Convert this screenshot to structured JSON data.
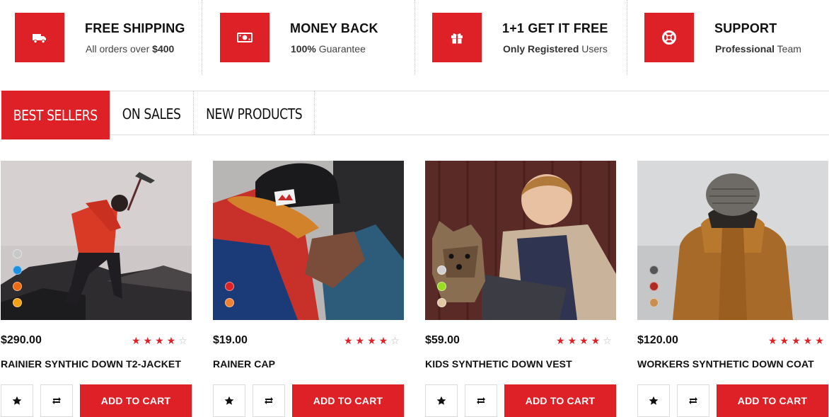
{
  "features": [
    {
      "icon": "truck-icon",
      "title": "FREE SHIPPING",
      "sub_pre": "All orders over ",
      "sub_bold": "$400",
      "sub_post": ""
    },
    {
      "icon": "money-icon",
      "title": "MONEY BACK",
      "sub_pre": "",
      "sub_bold": "100%",
      "sub_post": " Guarantee"
    },
    {
      "icon": "gift-icon",
      "title": "1+1 GET IT FREE",
      "sub_pre": "",
      "sub_bold": "Only Registered",
      "sub_post": " Users"
    },
    {
      "icon": "lifebuoy-icon",
      "title": "SUPPORT",
      "sub_pre": "",
      "sub_bold": "Professional",
      "sub_post": " Team"
    }
  ],
  "tabs": [
    {
      "label": "BEST SELLERS",
      "active": true
    },
    {
      "label": "ON SALES",
      "active": false
    },
    {
      "label": "NEW PRODUCTS",
      "active": false
    }
  ],
  "colors": {
    "accent": "#dd2127"
  },
  "products": [
    {
      "name": "RAINIER SYNTHIC DOWN T2-JACKET",
      "price": "$290.00",
      "rating": 4,
      "max_rating": 5,
      "swatches": [
        "#c8c8c8",
        "#1e90e0",
        "#ee6a12",
        "#f0a010"
      ],
      "cart_label": "ADD TO CART",
      "wishlist_icon": "star-icon",
      "compare_icon": "repeat-icon"
    },
    {
      "name": "RAINER CAP",
      "price": "$19.00",
      "rating": 4,
      "max_rating": 5,
      "swatches": [
        "#dd2127",
        "#ee8030"
      ],
      "cart_label": "ADD TO CART",
      "wishlist_icon": "star-icon",
      "compare_icon": "repeat-icon"
    },
    {
      "name": "KIDS SYNTHETIC DOWN VEST",
      "price": "$59.00",
      "rating": 4,
      "max_rating": 5,
      "swatches": [
        "#d0d0d0",
        "#9adc20",
        "#e0c8a0"
      ],
      "cart_label": "ADD TO CART",
      "wishlist_icon": "star-icon",
      "compare_icon": "repeat-icon"
    },
    {
      "name": "WORKERS SYNTHETIC DOWN COAT",
      "price": "$120.00",
      "rating": 5,
      "max_rating": 5,
      "swatches": [
        "#555555",
        "#b02a24",
        "#c89050"
      ],
      "cart_label": "ADD TO CART",
      "wishlist_icon": "star-icon",
      "compare_icon": "repeat-icon"
    }
  ]
}
